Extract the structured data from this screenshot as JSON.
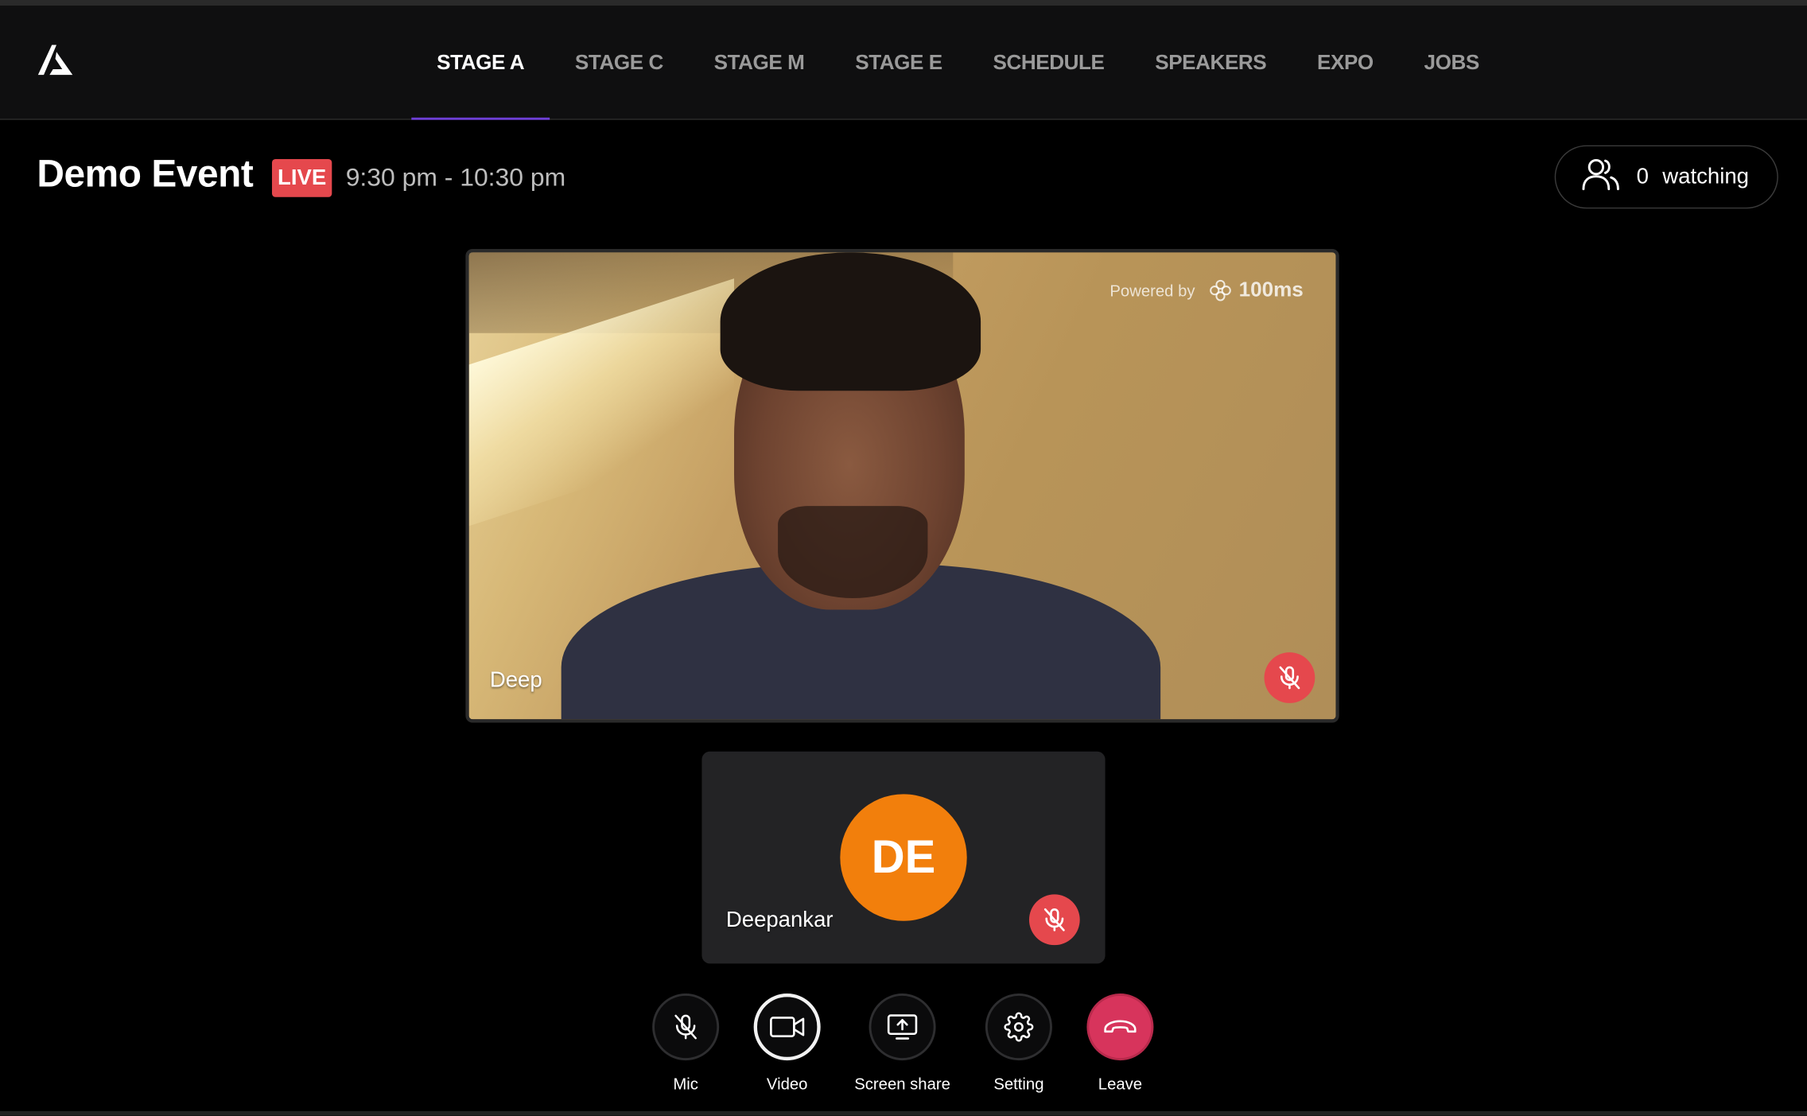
{
  "nav": {
    "items": [
      {
        "label": "STAGE A",
        "active": true
      },
      {
        "label": "STAGE C",
        "active": false
      },
      {
        "label": "STAGE M",
        "active": false
      },
      {
        "label": "STAGE E",
        "active": false
      },
      {
        "label": "SCHEDULE",
        "active": false
      },
      {
        "label": "SPEAKERS",
        "active": false
      },
      {
        "label": "EXPO",
        "active": false
      },
      {
        "label": "JOBS",
        "active": false
      }
    ],
    "active_color": "#6d3fd6"
  },
  "event": {
    "title": "Demo Event",
    "live_label": "LIVE",
    "time": "9:30 pm - 10:30 pm"
  },
  "watching": {
    "count": "0",
    "label": "watching",
    "icon": "users-icon"
  },
  "video_tile": {
    "name": "Deep",
    "powered_by": "Powered by",
    "brand": "100ms",
    "mic_muted": true
  },
  "audio_tile": {
    "initials": "DE",
    "name": "Deepankar",
    "avatar_color": "#f27f0c",
    "mic_muted": true
  },
  "controls": {
    "mic": {
      "label": "Mic",
      "icon": "mic-off-icon"
    },
    "video": {
      "label": "Video",
      "icon": "video-camera-icon"
    },
    "screen_share": {
      "label": "Screen share",
      "icon": "screen-share-icon"
    },
    "setting": {
      "label": "Setting",
      "icon": "gear-icon"
    },
    "leave": {
      "label": "Leave",
      "icon": "hang-up-icon"
    }
  },
  "colors": {
    "live": "#e5484d",
    "mute": "#e5484d",
    "leave": "#d7345c"
  }
}
